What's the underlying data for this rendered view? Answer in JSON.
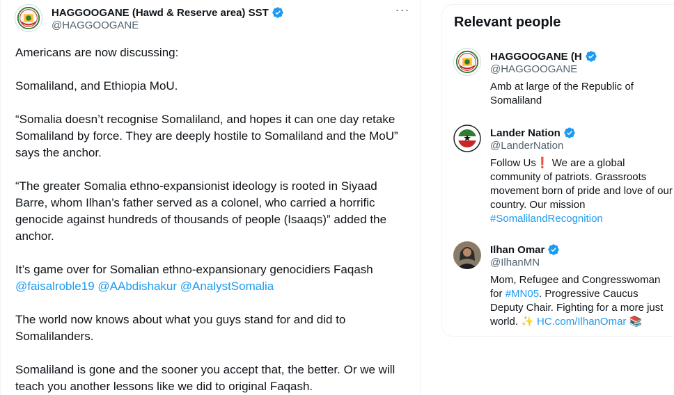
{
  "tweet": {
    "author_name": "HAGGOOGANE (Hawd & Reserve area) SST",
    "author_handle": "@HAGGOOGANE",
    "more_label": "···",
    "paragraphs": {
      "p1": "Americans are now discussing:",
      "p2": "Somaliland, and Ethiopia MoU.",
      "p3": "“Somalia doesn’t recognise Somaliland, and hopes it can one day retake Somaliland by force. They are deeply hostile to Somaliland and the MoU” says the anchor.",
      "p4": "“The greater Somalia ethno-expansionist ideology is rooted in Siyaad Barre, whom Ilhan’s father served as a colonel, who carried a horrific genocide against hundreds of thousands of people (Isaaqs)” added the anchor.",
      "p5_text": "It’s game over for Somalian ethno-expansionary genocidiers Faqash",
      "p5_mentions": [
        "@faisalroble19",
        "@AAbdishakur",
        "@AnalystSomalia"
      ],
      "p6": "The world now knows about what you guys stand for and did to Somalilanders.",
      "p7": "Somaliland is gone and the sooner you accept that, the better. Or we will teach you another lessons like we did to original Faqash."
    }
  },
  "sidebar": {
    "title": "Relevant people",
    "people": [
      {
        "name": "HAGGOOGANE (H",
        "handle": "@HAGGOOGANE",
        "bio": "Amb at large of the Republic of Somaliland"
      },
      {
        "name": "Lander Nation",
        "handle": "@LanderNation",
        "bio_pre": "Follow Us",
        "bio_emoji": "❗",
        "bio_post": " We are a global community of patriots. Grassroots movement born of pride and love of our country. Our mission ",
        "bio_hashtag": "#SomalilandRecognition"
      },
      {
        "name": "Ilhan Omar",
        "handle": "@IlhanMN",
        "bio_pre": "Mom, Refugee and Congresswoman for ",
        "bio_hashtag": "#MN05",
        "bio_mid": ". Progressive Caucus Deputy Chair. Fighting for a more just world. ",
        "bio_sparkle": "✨",
        "bio_link": "HC.com/IlhanOmar",
        "bio_books": "📚"
      }
    ]
  },
  "colors": {
    "accent": "#1d9bf0",
    "text": "#0f1419",
    "secondary": "#536471"
  }
}
